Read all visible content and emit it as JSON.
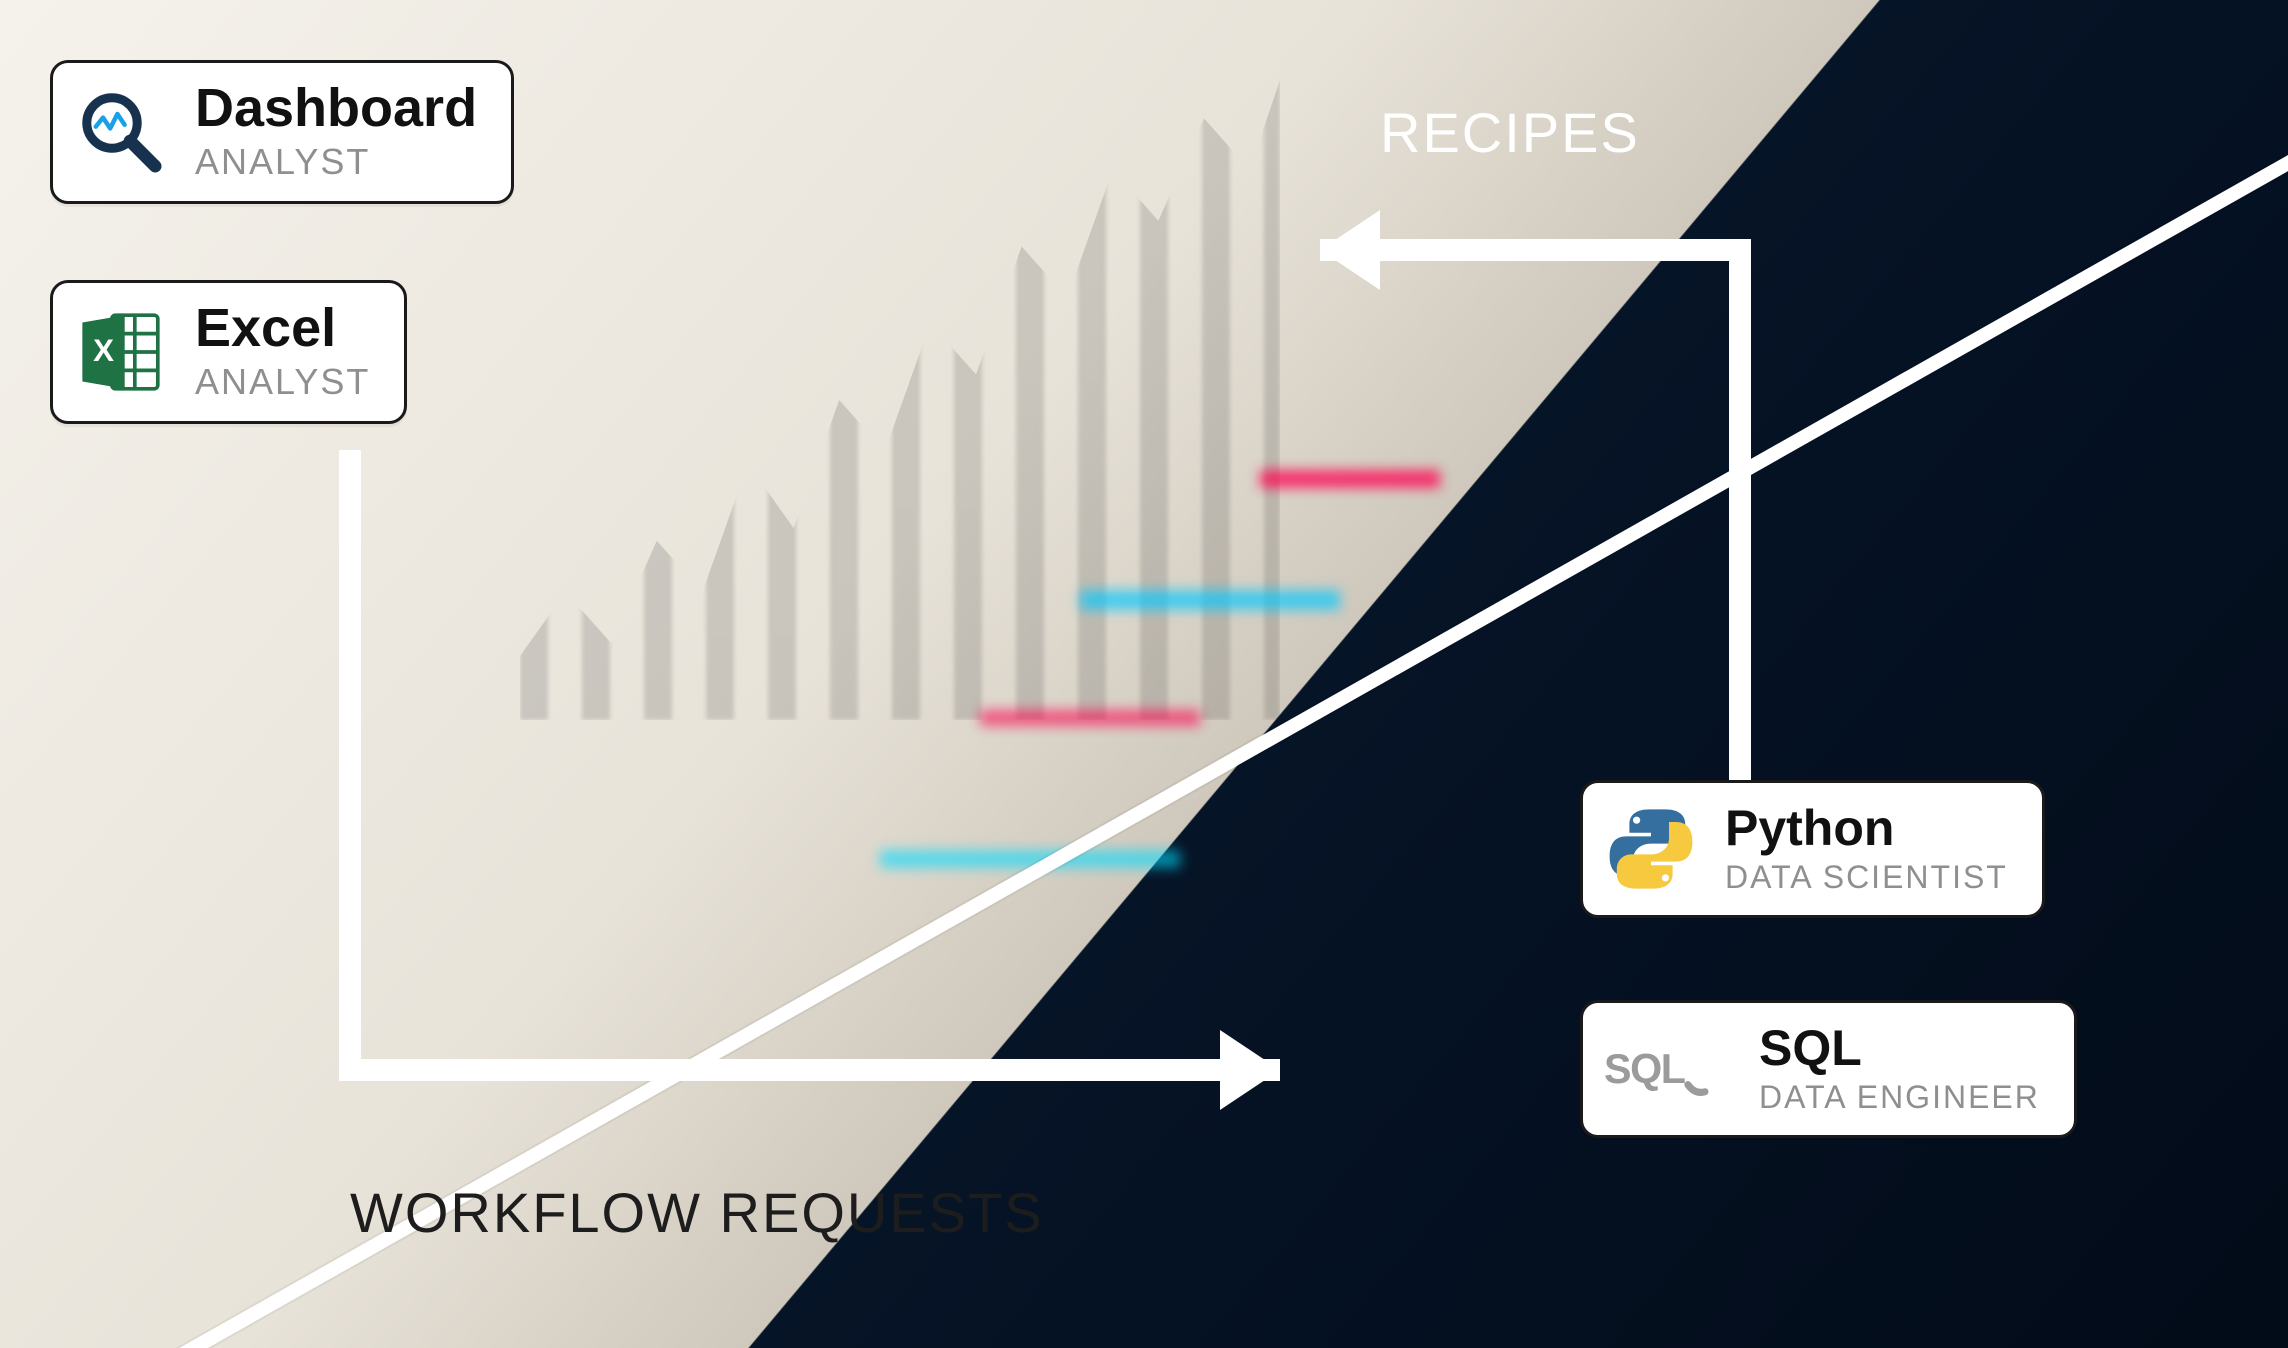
{
  "labels": {
    "recipes": "RECIPES",
    "workflow_requests": "WORKFLOW REQUESTS"
  },
  "cards": {
    "dashboard": {
      "title": "Dashboard",
      "role": "ANALYST",
      "icon": "dashboard-search-icon"
    },
    "excel": {
      "title": "Excel",
      "role": "ANALYST",
      "icon": "excel-icon"
    },
    "python": {
      "title": "Python",
      "role": "DATA SCIENTIST",
      "icon": "python-icon"
    },
    "sql": {
      "title": "SQL",
      "role": "DATA ENGINEER",
      "icon": "sql-icon"
    }
  },
  "flow": {
    "top_arrow": {
      "from": "python/sql",
      "to": "dashboard/excel",
      "label_key": "recipes"
    },
    "bottom_arrow": {
      "from": "dashboard/excel",
      "to": "python/sql",
      "label_key": "workflow_requests"
    }
  }
}
